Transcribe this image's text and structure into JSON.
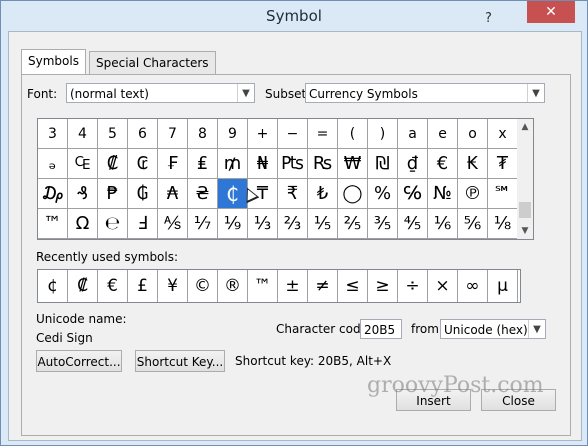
{
  "window": {
    "title": "Symbol",
    "help_label": "?",
    "close_label": "✕"
  },
  "tabs": [
    {
      "label": "Symbols",
      "active": true
    },
    {
      "label": "Special Characters",
      "active": false
    }
  ],
  "font": {
    "label": "Font:",
    "value": "(normal text)"
  },
  "subset": {
    "label": "Subset:",
    "value": "Currency Symbols"
  },
  "grid": {
    "rows": [
      [
        "3",
        "4",
        "5",
        "6",
        "7",
        "8",
        "9",
        "+",
        "−",
        "=",
        "(",
        ")",
        "a",
        "e",
        "o",
        "x"
      ],
      [
        "ₔ",
        "₠",
        "₡",
        "₢",
        "₣",
        "₤",
        "₥",
        "₦",
        "₧",
        "₨",
        "₩",
        "₪",
        "₫",
        "€",
        "₭",
        "₮"
      ],
      [
        "₯",
        "₰",
        "₱",
        "₲",
        "₳",
        "₴",
        "₵",
        "₸",
        "₹",
        "₺",
        "◯",
        "%",
        "℅",
        "№",
        "℗",
        "℠"
      ],
      [
        "™",
        "Ω",
        "℮",
        "Ⅎ",
        "⅍",
        "⅐",
        "⅑",
        "⅓",
        "⅔",
        "⅕",
        "⅖",
        "⅗",
        "⅘",
        "⅙",
        "⅚",
        "⅛"
      ]
    ],
    "selected": "₵"
  },
  "recent": {
    "label": "Recently used symbols:",
    "symbols": [
      "¢",
      "₡",
      "€",
      "£",
      "¥",
      "©",
      "®",
      "™",
      "±",
      "≠",
      "≤",
      "≥",
      "÷",
      "×",
      "∞",
      "µ"
    ]
  },
  "unicode": {
    "name_label": "Unicode name:",
    "name_value": "Cedi Sign"
  },
  "char_code": {
    "label": "Character code:",
    "value": "20B5"
  },
  "from": {
    "label": "from:",
    "value": "Unicode (hex)"
  },
  "buttons": {
    "autocorrect": "AutoCorrect...",
    "shortcut": "Shortcut Key...",
    "insert": "Insert",
    "close": "Close"
  },
  "shortcut_text": "Shortcut key: 20B5, Alt+X",
  "watermark": "groovyPost.com",
  "colors": {
    "selection": "#2f77d7",
    "titlebar": "#dbe8f6",
    "close_button": "#c75050"
  }
}
